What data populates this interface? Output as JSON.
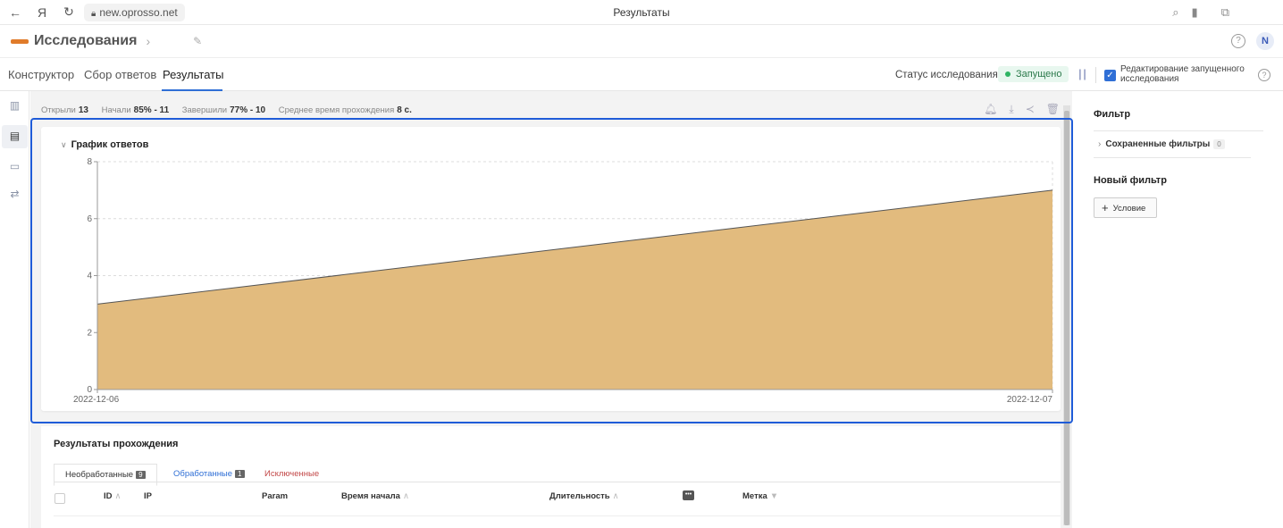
{
  "browser": {
    "url": "new.oprosso.net",
    "page_title": "Результаты"
  },
  "app": {
    "name": "Исследования",
    "avatar_initial": "N",
    "help_glyph": "?"
  },
  "tabs": [
    {
      "label": "Конструктор"
    },
    {
      "label": "Сбор ответов"
    },
    {
      "label": "Результаты"
    }
  ],
  "status": {
    "label": "Статус исследования:",
    "value": "Запущено",
    "edit_label": "Редактирование запущенного исследования"
  },
  "stats": {
    "opened_label": "Открыли",
    "opened_value": "13",
    "started_label": "Начали",
    "started_value": "85% - 11",
    "finished_label": "Завершили",
    "finished_value": "77% - 10",
    "avgtime_label": "Среднее время прохождения",
    "avgtime_value": "8 с."
  },
  "chart": {
    "title": "График ответов"
  },
  "chart_data": {
    "type": "area",
    "title": "График ответов",
    "x": [
      "2022-12-06",
      "2022-12-07"
    ],
    "values": [
      3,
      7
    ],
    "ylim": [
      0,
      8
    ],
    "yticks": [
      0,
      2,
      4,
      6,
      8
    ],
    "grid": true,
    "fill_color": "#e2bb7e",
    "line_color": "#555555"
  },
  "results": {
    "title": "Результаты прохождения",
    "tabs": [
      {
        "label": "Необработанные",
        "count": "9"
      },
      {
        "label": "Обработанные",
        "count": "1"
      },
      {
        "label": "Исключенные"
      }
    ],
    "columns": [
      "ID",
      "IP",
      "Param",
      "Время начала",
      "Длительность",
      "Метка"
    ]
  },
  "filter": {
    "title": "Фильтр",
    "saved_label": "Сохраненные фильтры",
    "saved_count": "0",
    "new_label": "Новый фильтр",
    "condition_button": "Условие"
  }
}
